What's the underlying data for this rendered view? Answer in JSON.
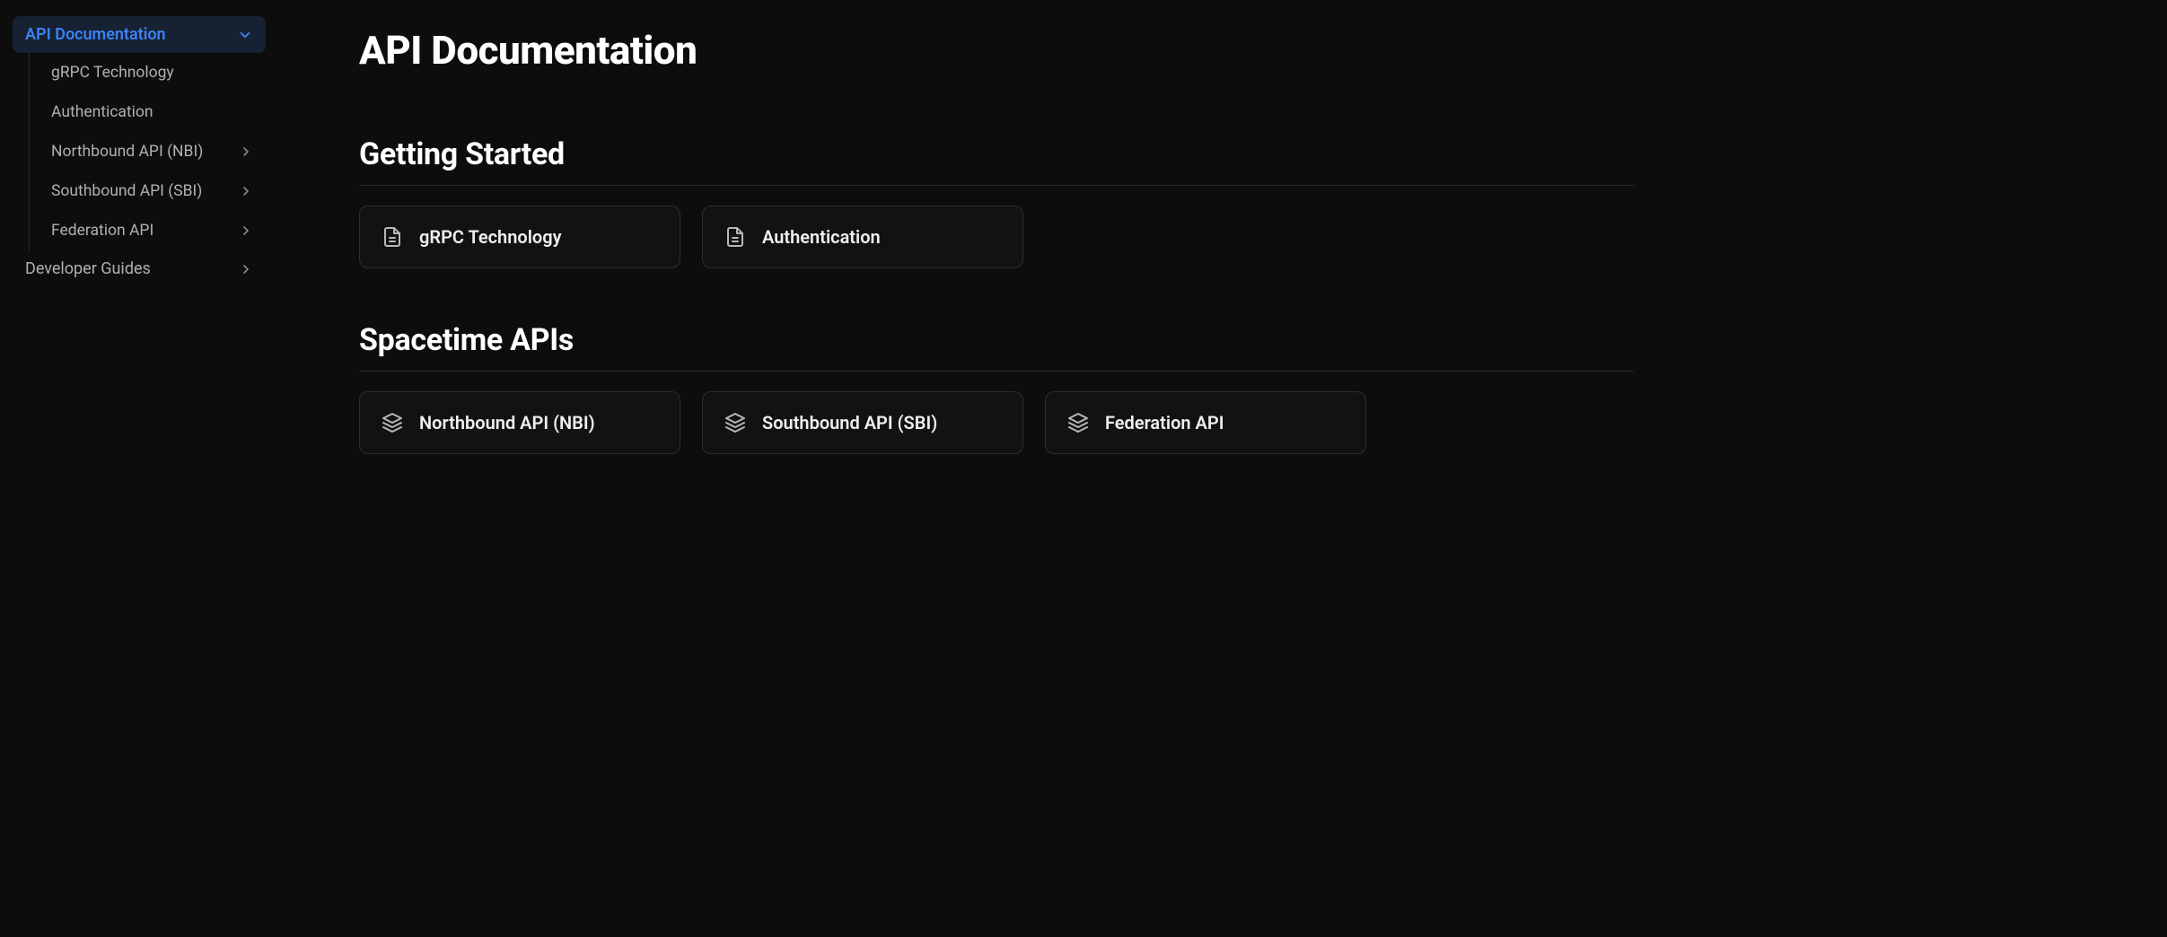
{
  "sidebar": {
    "active": {
      "label": "API Documentation"
    },
    "children": [
      {
        "label": "gRPC Technology",
        "expandable": false
      },
      {
        "label": "Authentication",
        "expandable": false
      },
      {
        "label": "Northbound API (NBI)",
        "expandable": true
      },
      {
        "label": "Southbound API (SBI)",
        "expandable": true
      },
      {
        "label": "Federation API",
        "expandable": true
      }
    ],
    "after": {
      "label": "Developer Guides"
    }
  },
  "main": {
    "title": "API Documentation",
    "sections": [
      {
        "heading": "Getting Started",
        "cards": [
          {
            "icon": "document",
            "label": "gRPC Technology"
          },
          {
            "icon": "document",
            "label": "Authentication"
          }
        ]
      },
      {
        "heading": "Spacetime APIs",
        "cards": [
          {
            "icon": "layers",
            "label": "Northbound API (NBI)"
          },
          {
            "icon": "layers",
            "label": "Southbound API (SBI)"
          },
          {
            "icon": "layers",
            "label": "Federation API"
          }
        ]
      }
    ]
  }
}
